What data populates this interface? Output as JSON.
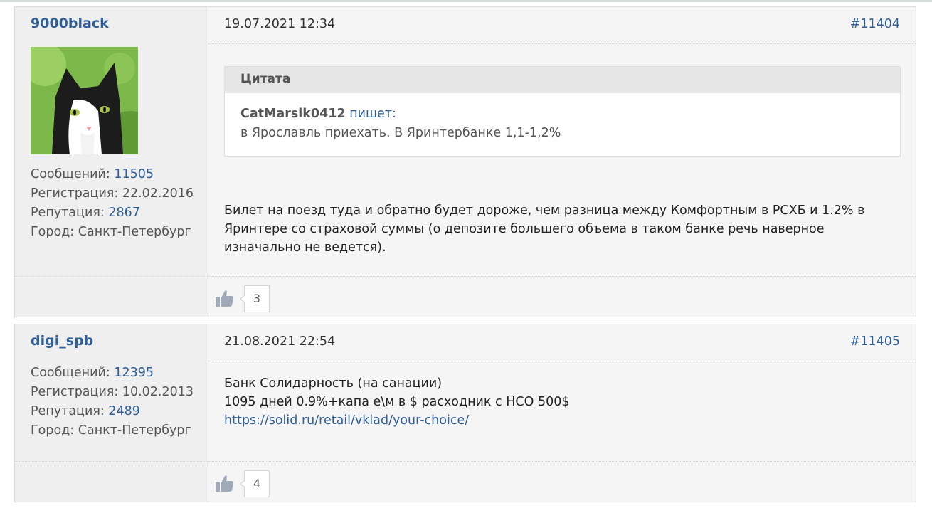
{
  "posts": [
    {
      "username": "9000black",
      "avatar_icon": "cat-avatar",
      "stats": {
        "messages_label": "Сообщений:",
        "messages_value": "11505",
        "registration_label": "Регистрация:",
        "registration_value": "22.02.2016",
        "reputation_label": "Репутация:",
        "reputation_value": "2867",
        "city_label": "Город:",
        "city_value": "Санкт-Петербург"
      },
      "date": "19.07.2021 12:34",
      "post_number": "#11404",
      "quote": {
        "title": "Цитата",
        "author": "CatMarsik0412",
        "writes": "пишет:",
        "text": "в Ярославль приехать. В Яринтербанке 1,1-1,2%"
      },
      "text": "Билет на поезд туда и обратно будет дороже, чем разница между Комфортным в РСХБ и 1.2% в Яринтере со страховой суммы (о депозите большего объема в таком банке речь наверное изначально не ведется).",
      "likes": "3"
    },
    {
      "username": "digi_spb",
      "stats": {
        "messages_label": "Сообщений:",
        "messages_value": "12395",
        "registration_label": "Регистрация:",
        "registration_value": "10.02.2013",
        "reputation_label": "Репутация:",
        "reputation_value": "2489",
        "city_label": "Город:",
        "city_value": "Санкт-Петербург"
      },
      "date": "21.08.2021 22:54",
      "post_number": "#11405",
      "text_lines": [
        "Банк Солидарность (на санации)",
        "1095 дней 0.9%+капа е\\м в $ расходник с НСО 500$"
      ],
      "link": "https://solid.ru/retail/vklad/your-choice/",
      "likes": "4"
    }
  ],
  "colors": {
    "link": "#2f5f94",
    "background": "#f2f2f2",
    "border": "#dcdcdc"
  },
  "icons": {
    "like": "thumbs-up-icon"
  }
}
